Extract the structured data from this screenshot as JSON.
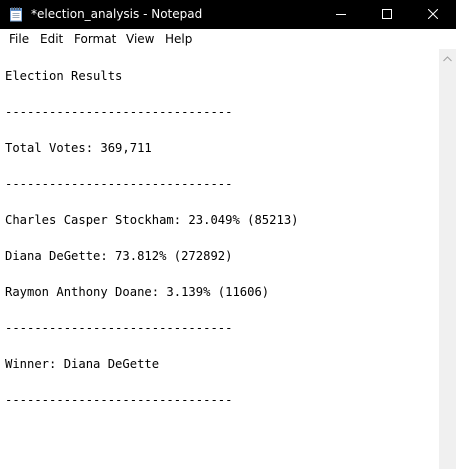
{
  "window": {
    "title": "*election_analysis - Notepad",
    "icon": "notepad-icon",
    "controls": [
      "minimize-icon",
      "maximize-icon",
      "close-icon"
    ]
  },
  "menu": {
    "items": [
      "File",
      "Edit",
      "Format",
      "View",
      "Help"
    ]
  },
  "document": {
    "lines": [
      "Election Results",
      "-------------------------------",
      "Total Votes: 369,711",
      "-------------------------------",
      "Charles Casper Stockham: 23.049% (85213)",
      "Diana DeGette: 73.812% (272892)",
      "Raymon Anthony Doane: 3.139% (11606)",
      "-------------------------------",
      "Winner: Diana DeGette",
      "-------------------------------"
    ]
  },
  "colors": {
    "titlebar": "#000000",
    "title_text": "#ffffff",
    "editor_bg": "#ffffff",
    "scrollbar_bg": "#f0f0f0"
  }
}
